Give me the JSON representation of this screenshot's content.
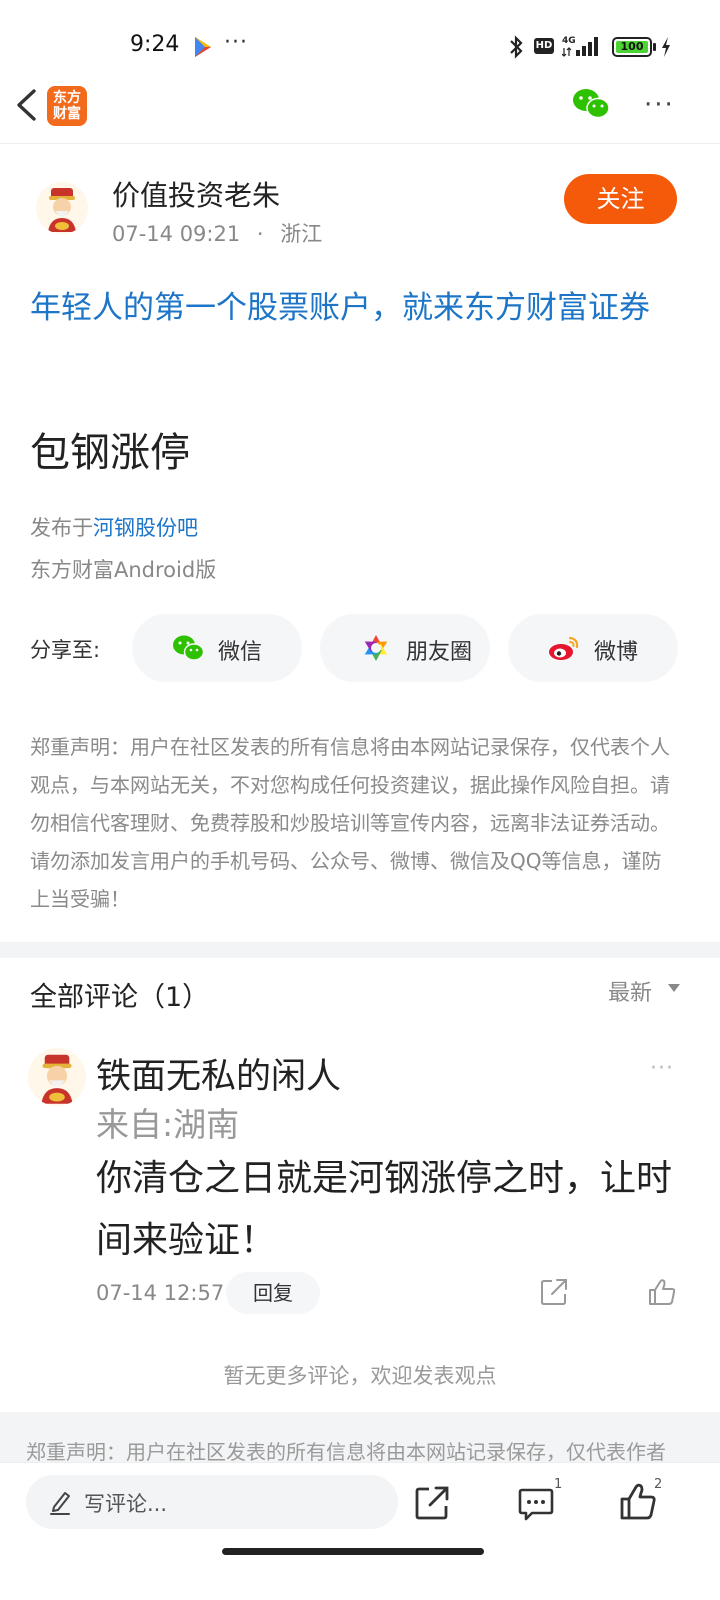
{
  "status_bar": {
    "time": "9:24",
    "dots": "···",
    "hd": "HD",
    "battery": "100"
  },
  "nav": {
    "app_logo": "东方\n财富",
    "more": "···"
  },
  "author": {
    "name": "价值投资老朱",
    "time": "07-14 09:21",
    "sep": "·",
    "location": "浙江",
    "follow_label": "关注"
  },
  "post": {
    "promo": "年轻人的第一个股票账户，就来东方财富证券",
    "title": "包钢涨停",
    "posted_in_prefix": "发布于",
    "bar_name": "河钢股份吧",
    "client": "东方财富Android版"
  },
  "share": {
    "label": "分享至:",
    "items": [
      {
        "label": "微信",
        "icon": "wechat-icon"
      },
      {
        "label": "朋友圈",
        "icon": "moments-icon"
      },
      {
        "label": "微博",
        "icon": "weibo-icon"
      }
    ]
  },
  "disclaimer": "郑重声明：用户在社区发表的所有信息将由本网站记录保存，仅代表个人观点，与本网站无关，不对您构成任何投资建议，据此操作风险自担。请勿相信代客理财、免费荐股和炒股培训等宣传内容，远离非法证券活动。请勿添加发言用户的手机号码、公众号、微博、微信及QQ等信息，谨防上当受骗！",
  "comments": {
    "title": "全部评论（1）",
    "sort_label": "最新",
    "items": [
      {
        "name": "铁面无私的闲人",
        "location": "来自:湖南",
        "text": "你清仓之日就是河钢涨停之时，让时间来验证！",
        "time": "07-14 12:57",
        "reply_label": "回复"
      }
    ],
    "no_more": "暂无更多评论，欢迎发表观点"
  },
  "footer_disclaimer": "郑重声明：用户在社区发表的所有信息将由本网站记录保存，仅代表作者",
  "bottom_bar": {
    "comment_placeholder": "写评论...",
    "comment_count": "1",
    "like_count": "2"
  },
  "colors": {
    "accent": "#f55a0a",
    "link": "#1d75c8",
    "brand": "#f26a1b"
  }
}
